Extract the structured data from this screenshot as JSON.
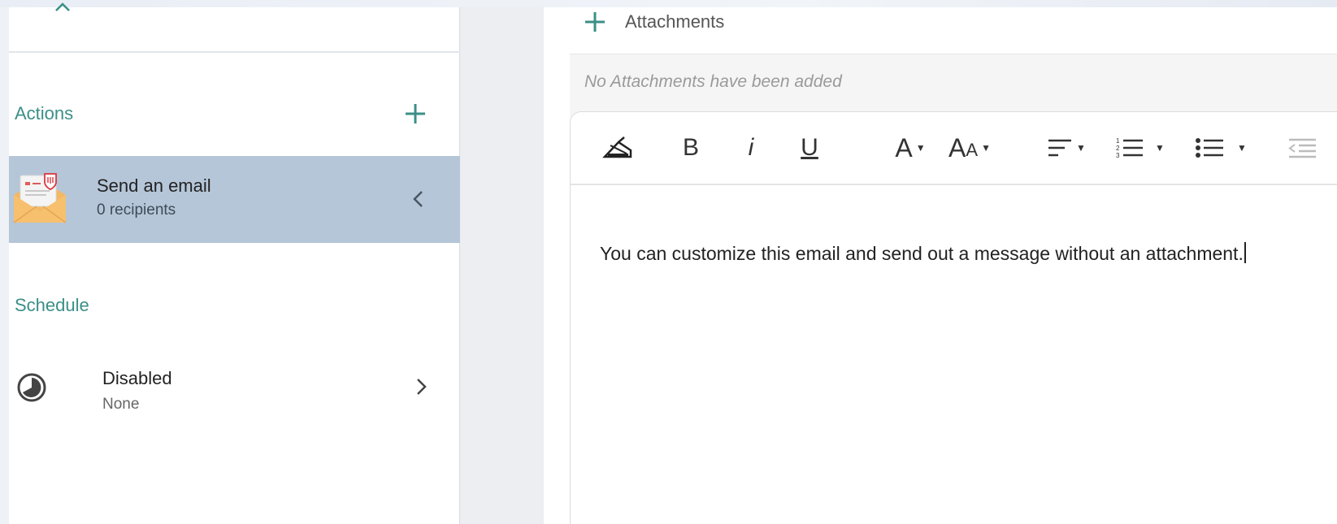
{
  "sidebar": {
    "actions": {
      "title": "Actions",
      "items": [
        {
          "title": "Send an email",
          "subtitle": "0 recipients",
          "selected": true
        }
      ]
    },
    "schedule": {
      "title": "Schedule",
      "status": "Disabled",
      "value": "None"
    }
  },
  "attachments": {
    "label": "Attachments",
    "empty_text": "No Attachments have been added"
  },
  "editor": {
    "toolbar": [
      "format-painter-icon",
      "bold-icon",
      "italic-icon",
      "underline-icon",
      "font-color-icon",
      "font-size-icon",
      "align-icon",
      "ordered-list-icon",
      "unordered-list-icon",
      "outdent-icon"
    ],
    "toolbar_text": {
      "bold": "B",
      "italic": "i",
      "underline": "U",
      "font": "A",
      "font_size_big": "A",
      "font_size_small": "A"
    },
    "body": "You can customize this email and send out a message without an attachment."
  },
  "colors": {
    "accent": "#3a8f87",
    "selected_row": "#b5c6d8"
  }
}
